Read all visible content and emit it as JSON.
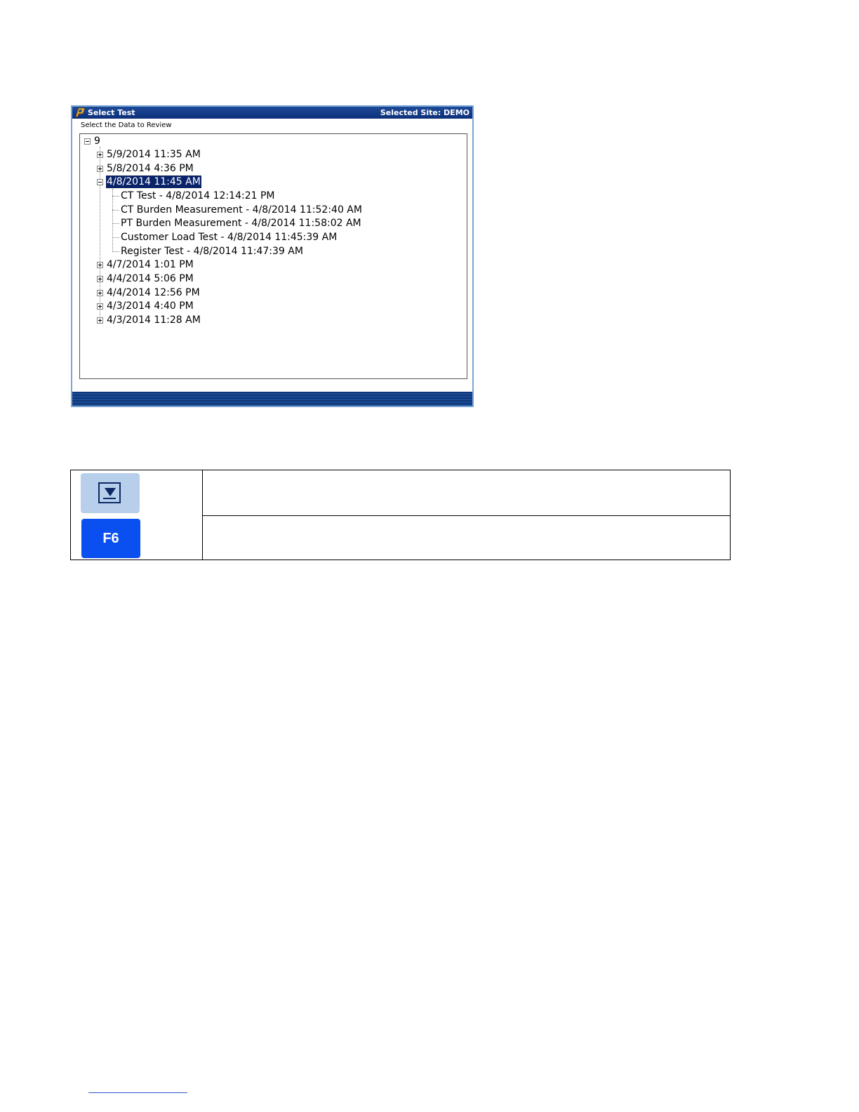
{
  "window": {
    "title": "Select Test",
    "site": "Selected Site: DEMO",
    "prompt": "Select the Data to Review"
  },
  "tree": {
    "root": "9",
    "dates": [
      {
        "label": "5/9/2014 11:35 AM",
        "expanded": false
      },
      {
        "label": "5/8/2014 4:36 PM",
        "expanded": false
      },
      {
        "label": "4/8/2014 11:45 AM",
        "expanded": true,
        "selected": true
      },
      {
        "label": "4/7/2014 1:01 PM",
        "expanded": false
      },
      {
        "label": "4/4/2014 5:06 PM",
        "expanded": false
      },
      {
        "label": "4/4/2014 12:56 PM",
        "expanded": false
      },
      {
        "label": "4/3/2014 4:40 PM",
        "expanded": false
      },
      {
        "label": "4/3/2014 11:28 AM",
        "expanded": false
      }
    ],
    "children": [
      "CT Test - 4/8/2014 12:14:21 PM",
      "CT Burden Measurement - 4/8/2014 11:52:40 AM",
      "PT Burden Measurement - 4/8/2014 11:58:02 AM",
      "Customer Load Test - 4/8/2014 11:45:39 AM",
      "Register Test - 4/8/2014 11:47:39 AM"
    ]
  },
  "keys": {
    "f6_label": "F6"
  },
  "colors": {
    "titlebar": "#0c2f7a",
    "selection": "#0a246a",
    "f6_key": "#0a4ff0",
    "scroll_key": "#b7cfea"
  }
}
